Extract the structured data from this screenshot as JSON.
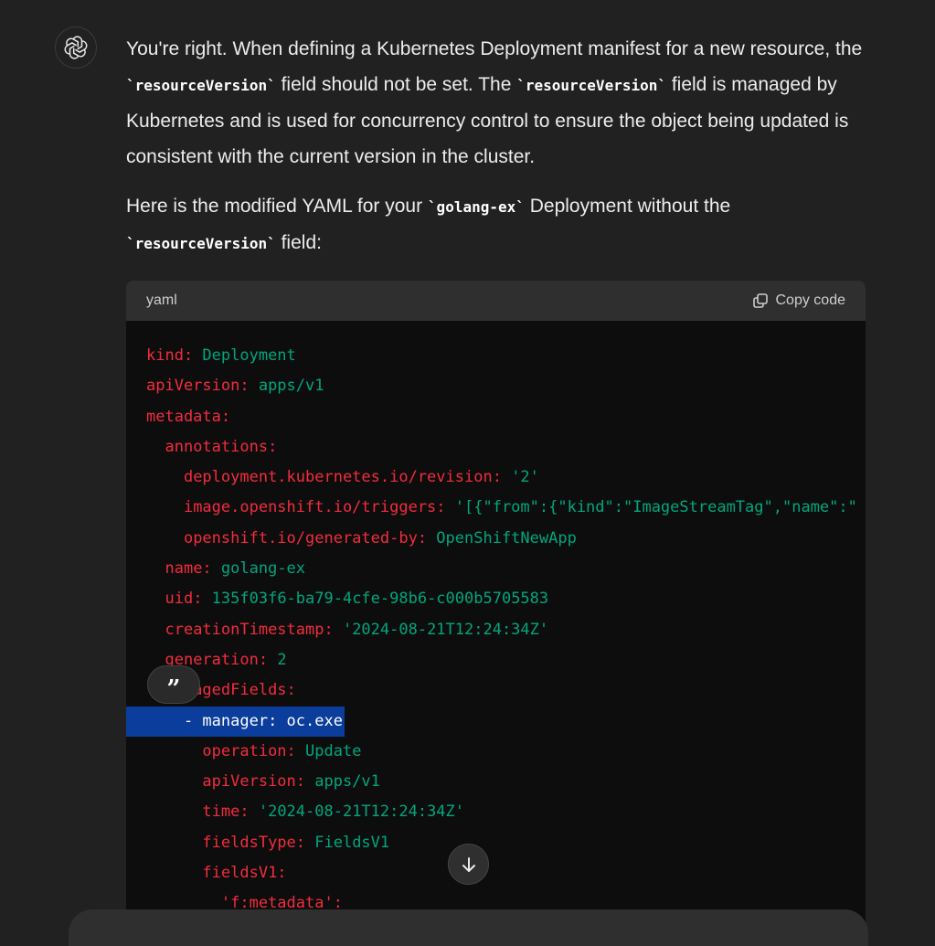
{
  "message": {
    "p1": {
      "t1": "You're right. When defining a Kubernetes Deployment manifest for a new resource, the ",
      "c1": "`resourceVersion`",
      "t2": " field should not be set. The ",
      "c2": "`resourceVersion`",
      "t3": " field is managed by Kubernetes and is used for concurrency control to ensure the object being updated is consistent with the current version in the cluster."
    },
    "p2": {
      "t1": "Here is the modified YAML for your ",
      "c1": "`golang-ex`",
      "t2": " Deployment without the ",
      "c2": "`resourceVersion`",
      "t3": " field:"
    }
  },
  "code": {
    "language": "yaml",
    "copy_label": "Copy code",
    "lines": [
      {
        "indent": "",
        "key": "kind:",
        "value": " Deployment"
      },
      {
        "indent": "",
        "key": "apiVersion:",
        "value": " apps/v1"
      },
      {
        "indent": "",
        "key": "metadata:",
        "value": ""
      },
      {
        "indent": "  ",
        "key": "annotations:",
        "value": ""
      },
      {
        "indent": "    ",
        "key": "deployment.kubernetes.io/revision:",
        "value": " '2'"
      },
      {
        "indent": "    ",
        "key": "image.openshift.io/triggers:",
        "value": " '[{\"from\":{\"kind\":\"ImageStreamTag\",\"name\":\""
      },
      {
        "indent": "    ",
        "key": "openshift.io/generated-by:",
        "value": " OpenShiftNewApp"
      },
      {
        "indent": "  ",
        "key": "name:",
        "value": " golang-ex"
      },
      {
        "indent": "  ",
        "key": "uid:",
        "value": " 135f03f6-ba79-4cfe-98b6-c000b5705583"
      },
      {
        "indent": "  ",
        "key": "creationTimestamp:",
        "value": " '2024-08-21T12:24:34Z'"
      },
      {
        "indent": "  ",
        "key": "generation:",
        "value": " 2"
      },
      {
        "indent": "  ",
        "key": "managedFields:",
        "value": ""
      },
      {
        "indent": "    ",
        "key": "- manager:",
        "value": " oc.exe",
        "selected": true
      },
      {
        "indent": "      ",
        "key": "operation:",
        "value": " Update"
      },
      {
        "indent": "      ",
        "key": "apiVersion:",
        "value": " apps/v1"
      },
      {
        "indent": "      ",
        "key": "time:",
        "value": " '2024-08-21T12:24:34Z'"
      },
      {
        "indent": "      ",
        "key": "fieldsType:",
        "value": " FieldsV1"
      },
      {
        "indent": "      ",
        "key": "fieldsV1:",
        "value": ""
      },
      {
        "indent": "        ",
        "key": "'f:metadata':",
        "value": ""
      }
    ]
  },
  "icons": {
    "avatar": "openai-logo-icon",
    "copy": "copy-icon",
    "quote": "quote-icon",
    "scroll": "arrow-down-icon"
  },
  "colors": {
    "background": "#212121",
    "code_background": "#0d0d0d",
    "code_header": "#2f2f2f",
    "yaml_key": "#f22c3d",
    "yaml_value": "#00a67d",
    "selection": "#0a3d9c"
  }
}
